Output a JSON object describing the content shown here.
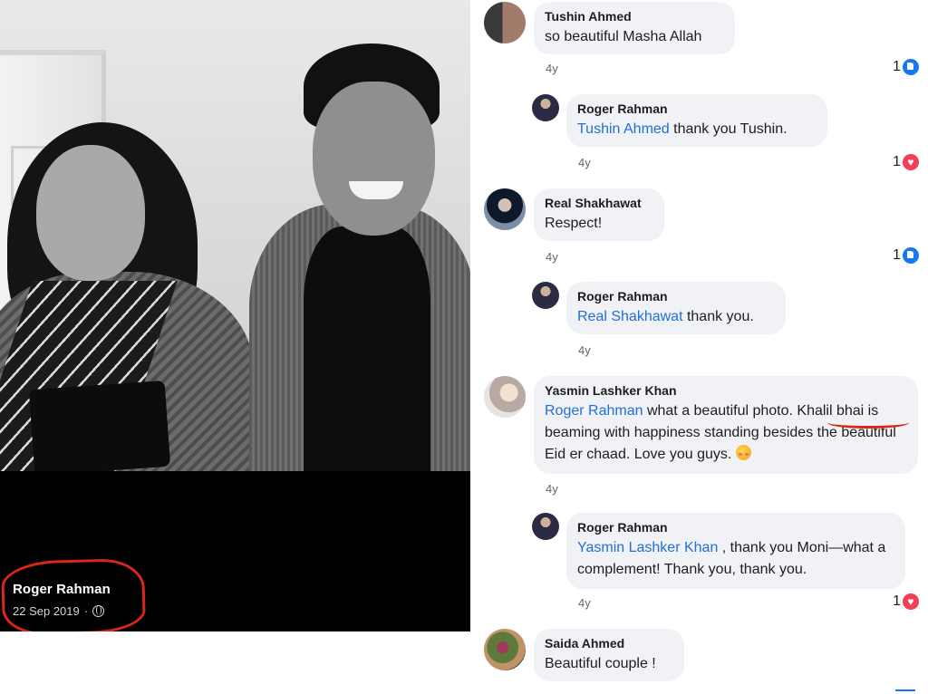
{
  "post": {
    "author": "Roger Rahman",
    "date": "22 Sep 2019",
    "separator": "·"
  },
  "colors": {
    "mention": "#216fdb",
    "bubble_bg": "#f0f2f5",
    "highlight": "#d8261c",
    "like": "#1877f2",
    "love": "#f33e58"
  },
  "comments": [
    {
      "name": "Tushin Ahmed",
      "text": "so beautiful Masha Allah",
      "time": "4y",
      "reaction_count": "1",
      "reaction_icon": "like-icon"
    },
    {
      "name": "Roger Rahman",
      "mention": "Tushin Ahmed",
      "text": " thank you Tushin.",
      "time": "4y",
      "reaction_count": "1",
      "reaction_icon": "love-icon"
    },
    {
      "name": "Real Shakhawat",
      "text": "Respect!",
      "time": "4y",
      "reaction_count": "1",
      "reaction_icon": "like-icon"
    },
    {
      "name": "Roger Rahman",
      "mention": "Real Shakhawat",
      "text": " thank you.",
      "time": "4y"
    },
    {
      "name": "Yasmin Lashker Khan",
      "mention": "Roger Rahman",
      "text": " what a beautiful photo. Khalil bhai is beaming with happiness standing besides the beautiful Eid er chaad. Love you guys.",
      "emoji": "smiling-face-with-hearts-icon",
      "time": "4y"
    },
    {
      "name": "Roger Rahman",
      "mention": "Yasmin Lashker Khan",
      "text": " , thank you Moni—what a complement! Thank you, thank you.",
      "time": "4y",
      "reaction_count": "1",
      "reaction_icon": "love-icon"
    },
    {
      "name": "Saida Ahmed",
      "text": "Beautiful couple !"
    }
  ]
}
